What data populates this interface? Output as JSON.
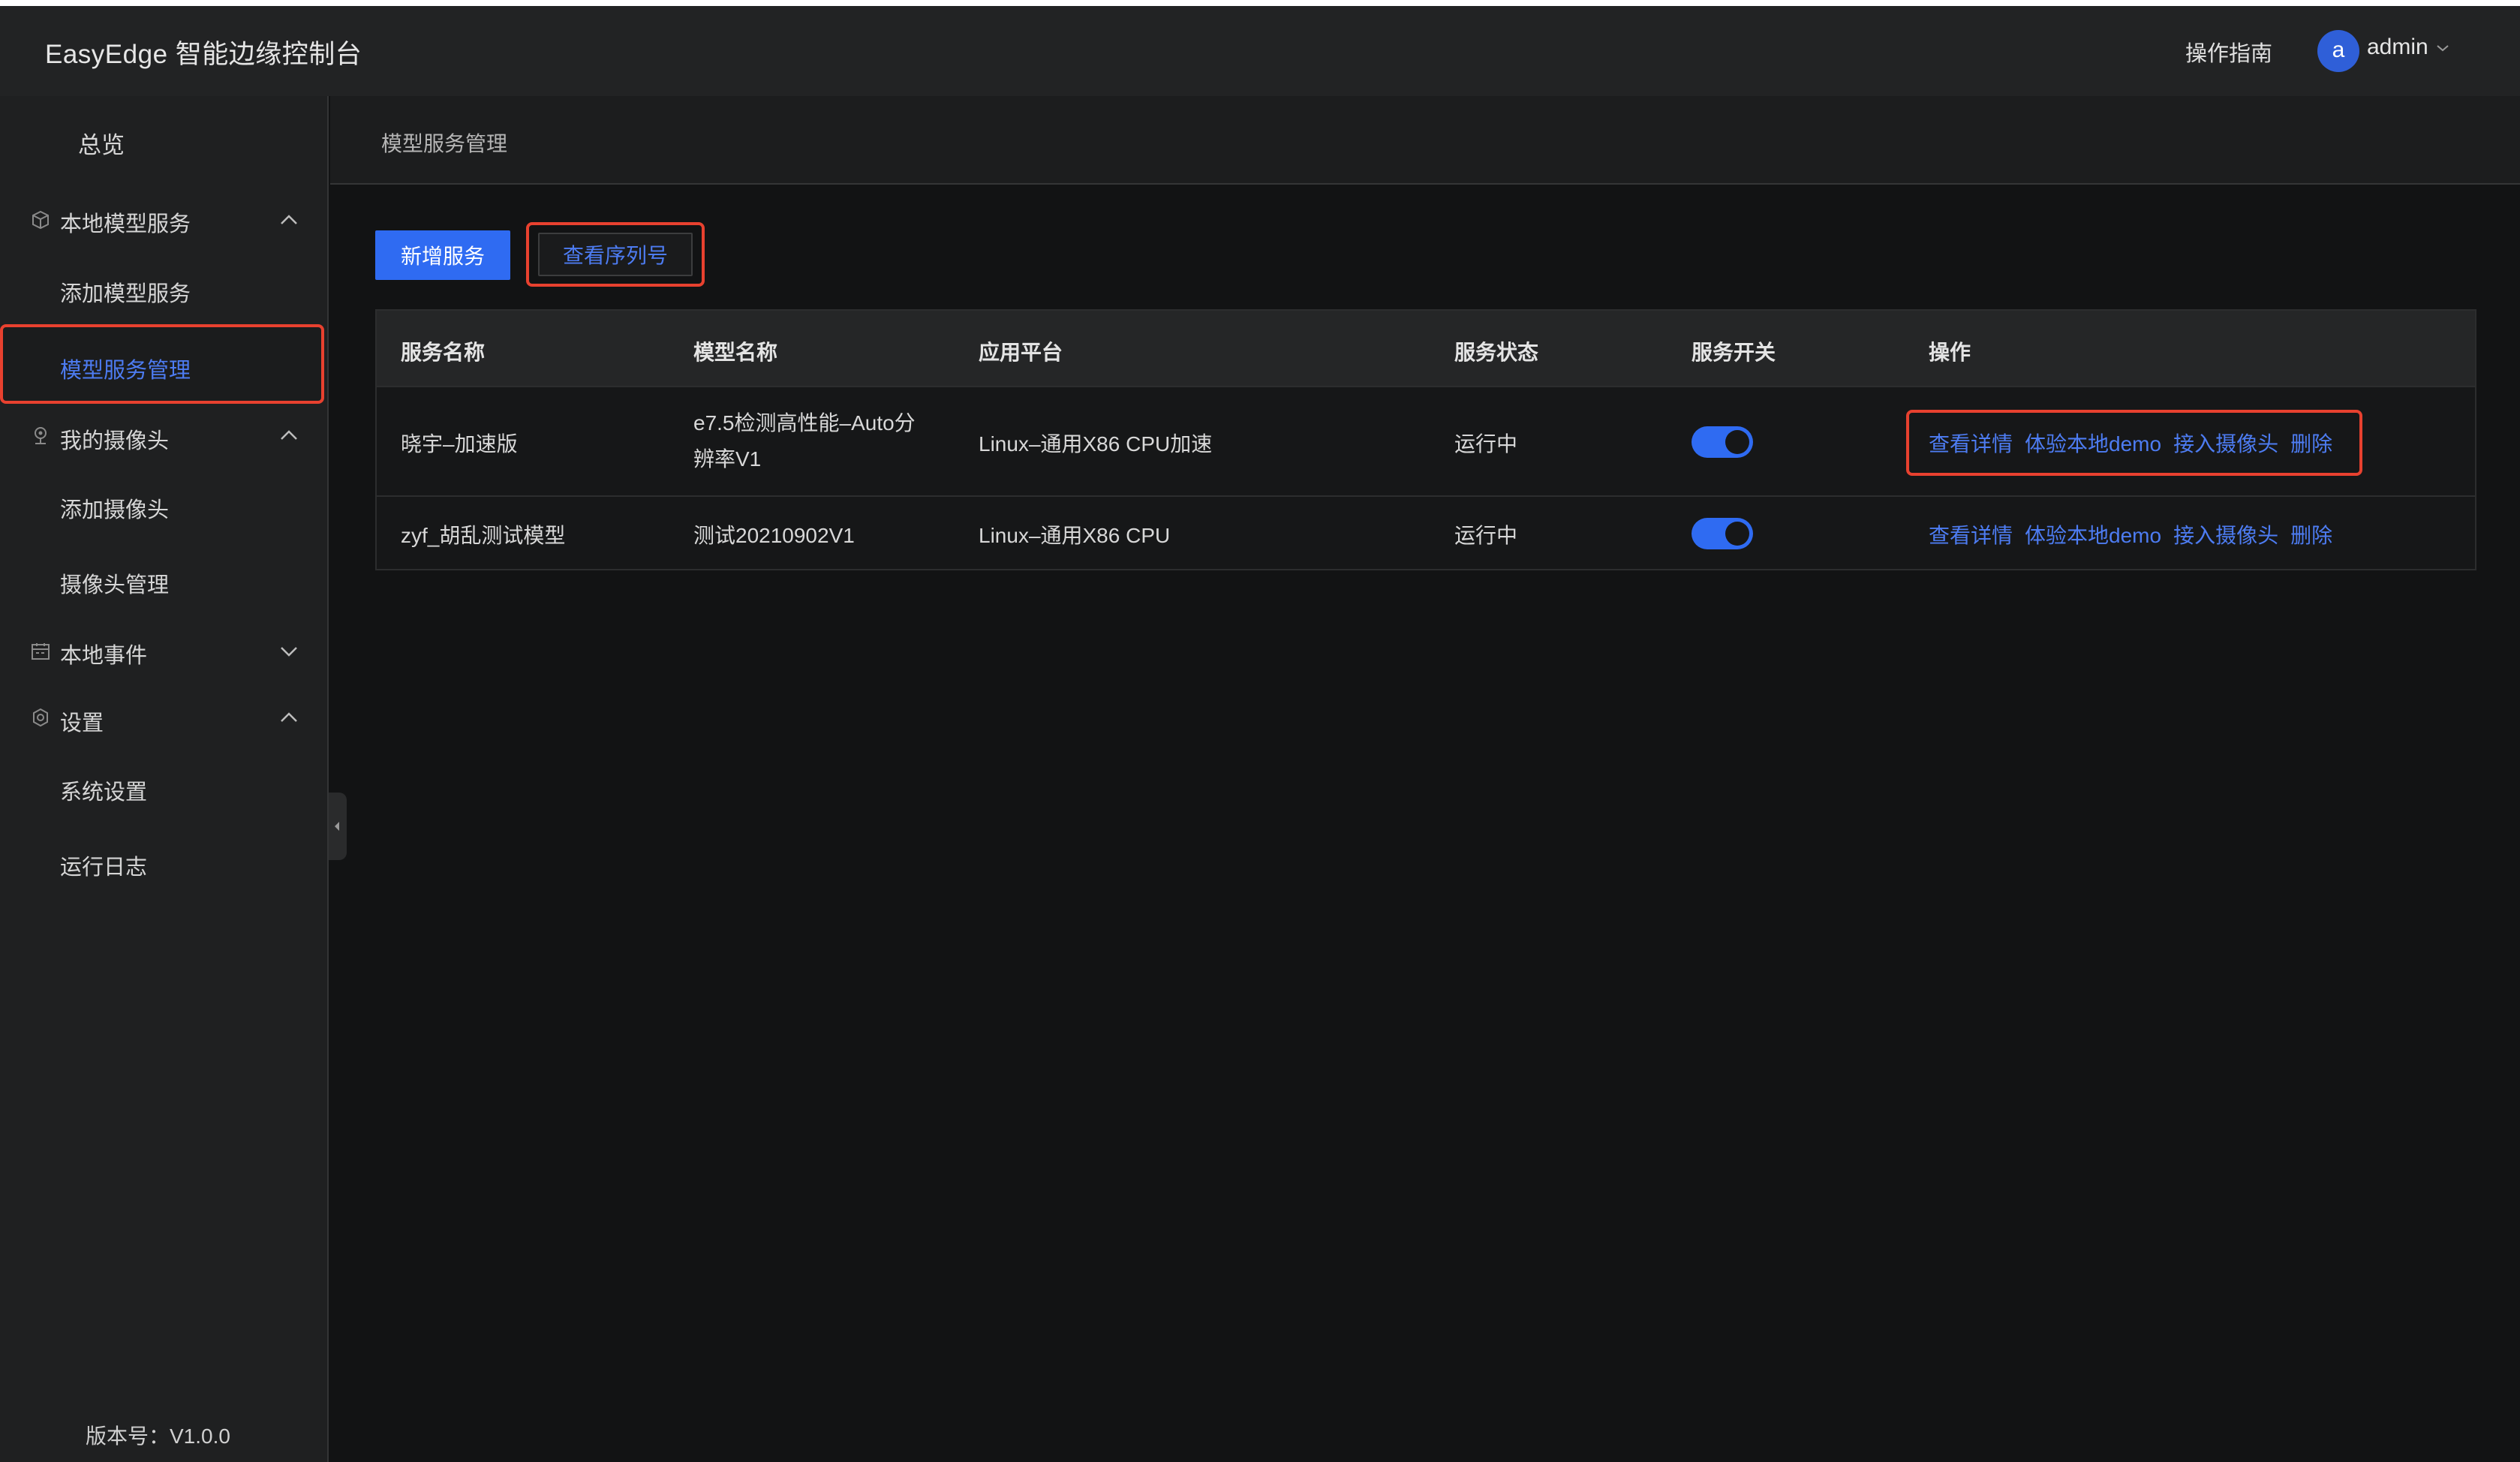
{
  "header": {
    "app_title": "EasyEdge 智能边缘控制台",
    "guide": "操作指南",
    "avatar_letter": "a",
    "user_name": "admin"
  },
  "sidebar": {
    "overview": "总览",
    "groups": [
      {
        "label": "本地模型服务",
        "icon": "cube-icon",
        "expanded": true
      },
      {
        "label": "我的摄像头",
        "icon": "camera-location-icon",
        "expanded": true
      },
      {
        "label": "本地事件",
        "icon": "calendar-icon",
        "expanded": false
      },
      {
        "label": "设置",
        "icon": "gear-icon",
        "expanded": true
      }
    ],
    "items": {
      "add_model_service": "添加模型服务",
      "model_service_manage": "模型服务管理",
      "add_camera": "添加摄像头",
      "camera_manage": "摄像头管理",
      "system_settings": "系统设置",
      "run_log": "运行日志"
    },
    "active_item": "模型服务管理",
    "version": "版本号：V1.0.0"
  },
  "breadcrumb": "模型服务管理",
  "toolbar": {
    "add_service": "新增服务",
    "view_serial": "查看序列号"
  },
  "table": {
    "columns": [
      "服务名称",
      "模型名称",
      "应用平台",
      "服务状态",
      "服务开关",
      "操作"
    ],
    "rows": [
      {
        "service_name": "晓宇–加速版",
        "model_name": "e7.5检测高性能–Auto分辨率V1",
        "platform": "Linux–通用X86 CPU加速",
        "status": "运行中",
        "switch_on": true
      },
      {
        "service_name": "zyf_胡乱测试模型",
        "model_name": "测试20210902V1",
        "platform": "Linux–通用X86 CPU",
        "status": "运行中",
        "switch_on": true
      }
    ],
    "actions": [
      "查看详情",
      "体验本地demo",
      "接入摄像头",
      "删除"
    ]
  },
  "colors": {
    "accent": "#2f6bf2",
    "link": "#4d7cf2",
    "highlight_border": "#e8412f"
  }
}
